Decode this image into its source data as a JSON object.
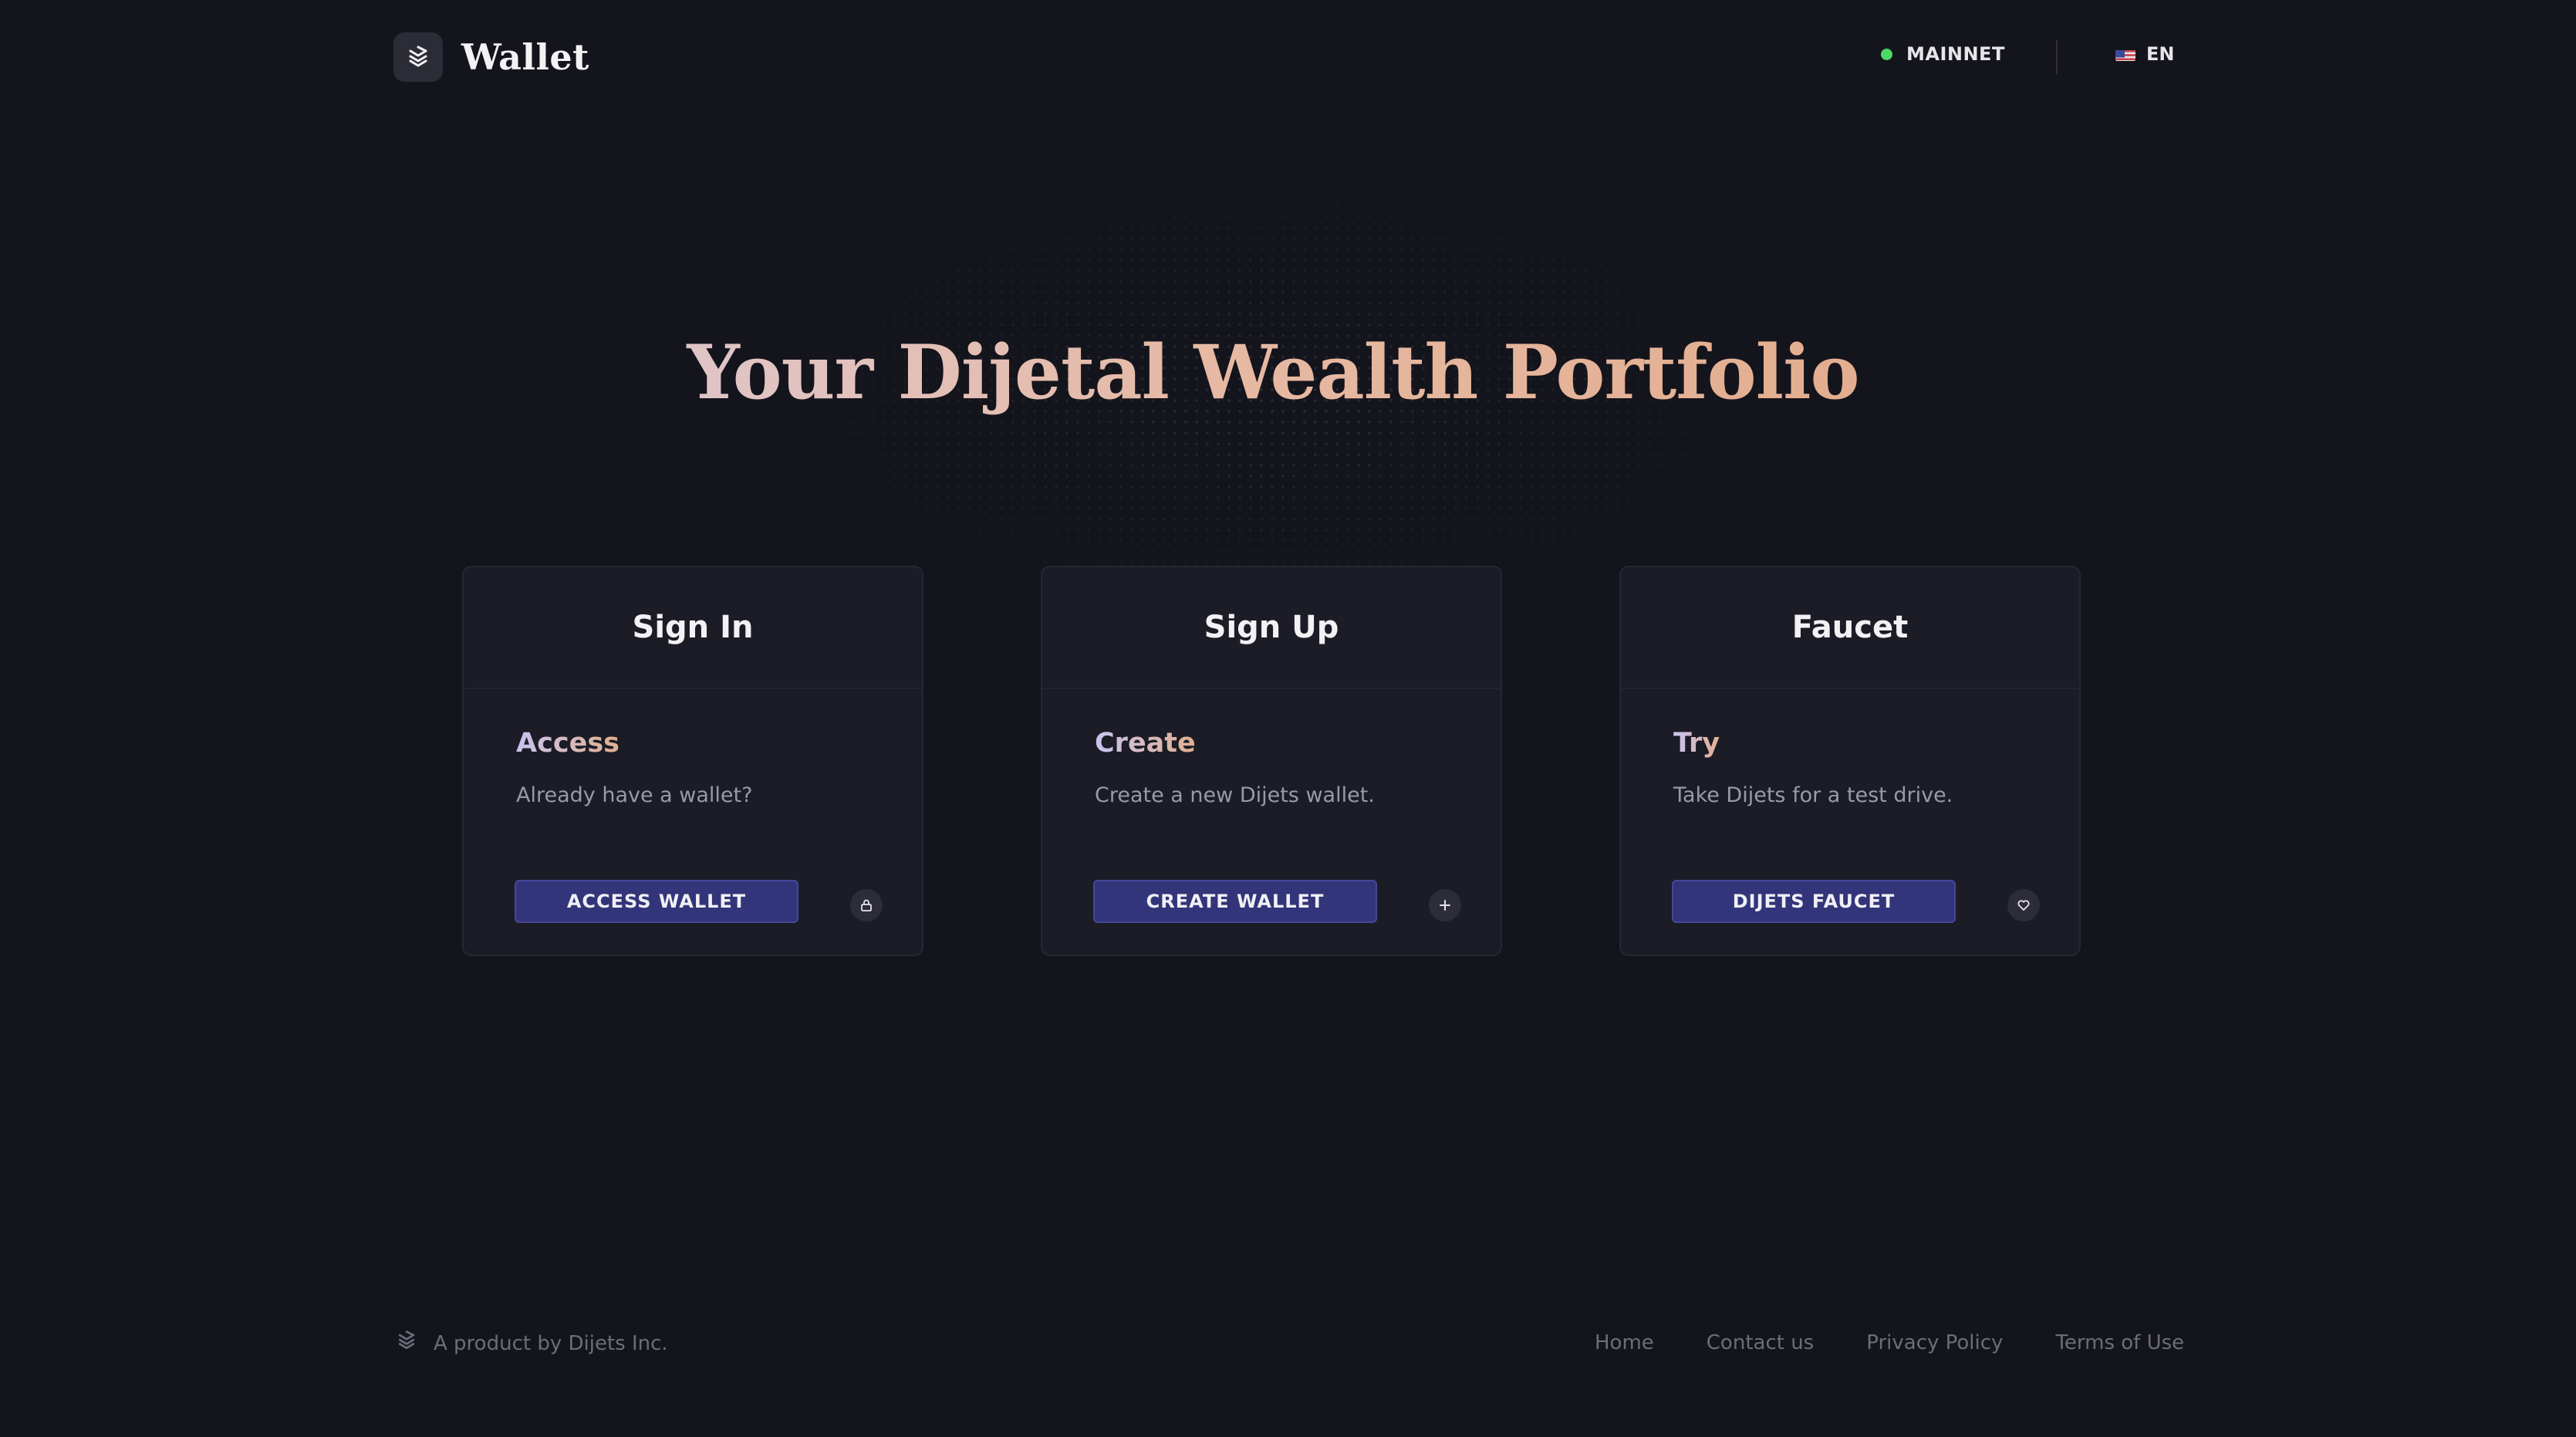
{
  "header": {
    "brand_title": "Wallet",
    "network_label": "MAINNET",
    "network_status_color": "#4cd964",
    "language_label": "EN",
    "language_flag_icon": "us-flag-icon",
    "logo_icon": "dijets-logo-icon"
  },
  "hero": {
    "headline": "Your Dijetal Wealth Portfolio"
  },
  "cards": [
    {
      "title": "Sign In",
      "subtitle": "Access",
      "description": "Already have a wallet?",
      "button_label": "ACCESS WALLET",
      "icon": "lock-icon"
    },
    {
      "title": "Sign Up",
      "subtitle": "Create",
      "description": "Create a new Dijets wallet.",
      "button_label": "CREATE WALLET",
      "icon": "plus-icon"
    },
    {
      "title": "Faucet",
      "subtitle": "Try",
      "description": "Take Dijets for a test drive.",
      "button_label": "DIJETS FAUCET",
      "icon": "heart-icon"
    }
  ],
  "footer": {
    "product_text": "A product by Dijets Inc.",
    "links": [
      "Home",
      "Contact us",
      "Privacy Policy",
      "Terms of Use"
    ]
  },
  "colors": {
    "background": "#14141c",
    "card_background": "#1b1c25",
    "button_background": "#33357a",
    "hero_gradient_start": "#d8d4f5",
    "hero_gradient_end": "#e0a27a"
  }
}
